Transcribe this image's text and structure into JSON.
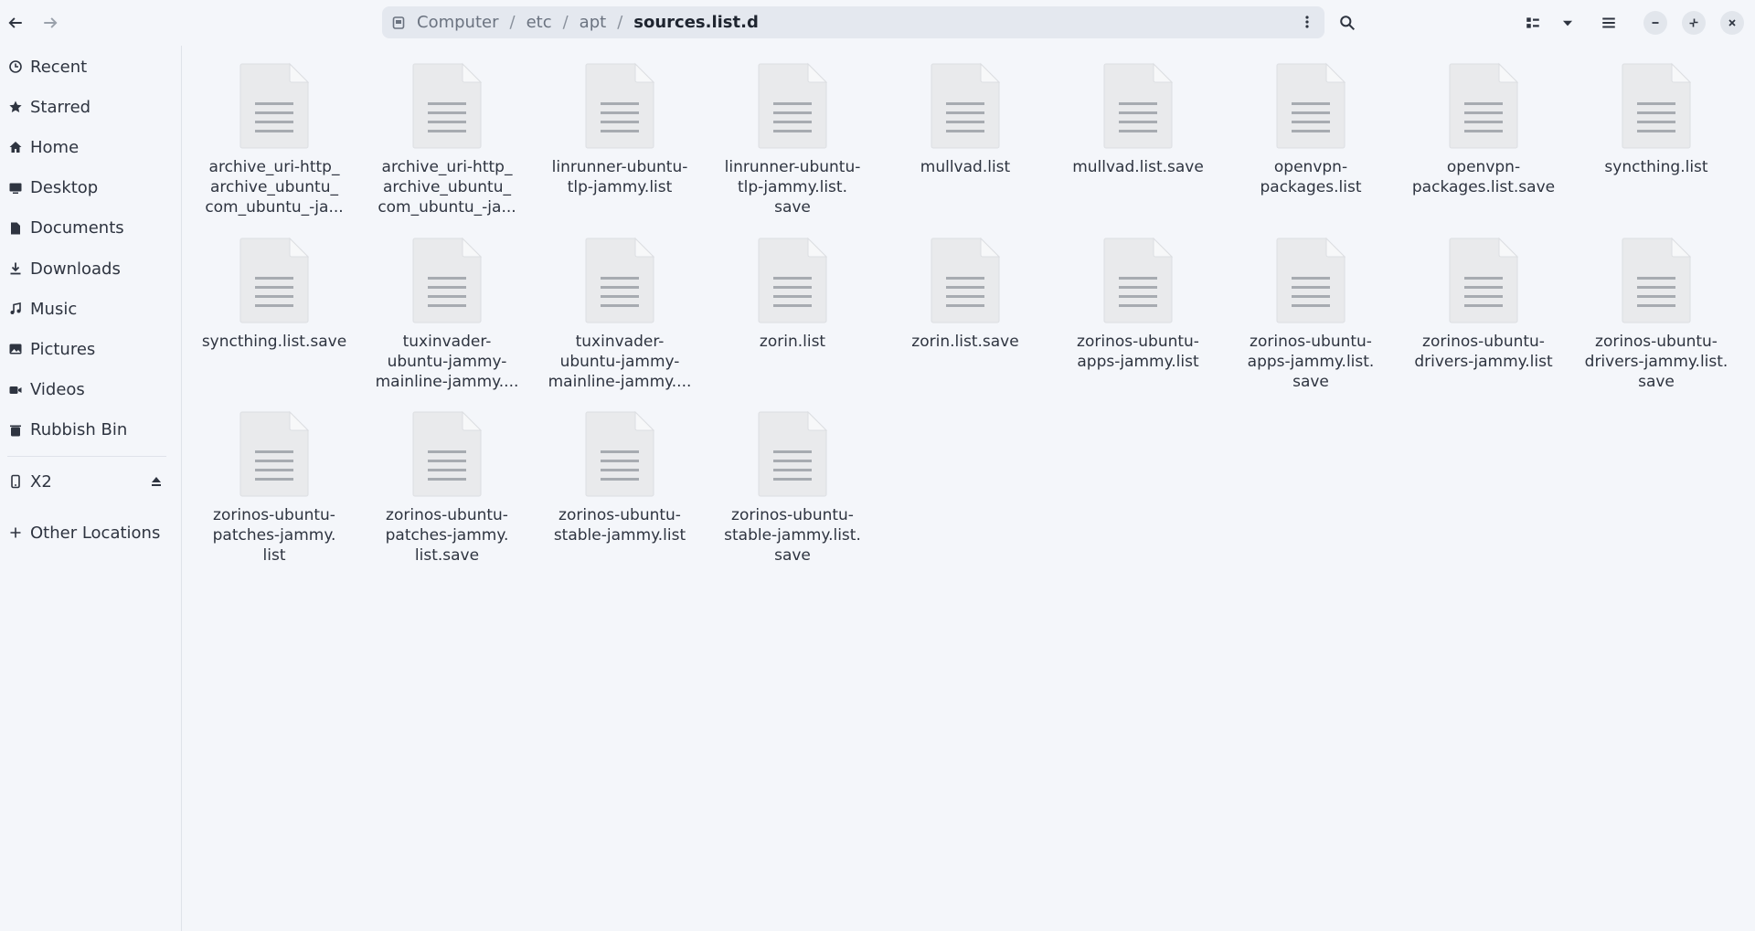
{
  "path": {
    "crumbs": [
      "Computer",
      "etc",
      "apt",
      "sources.list.d"
    ]
  },
  "sidebar": {
    "places": [
      {
        "label": "Recent",
        "icon": "clock-icon"
      },
      {
        "label": "Starred",
        "icon": "star-icon"
      },
      {
        "label": "Home",
        "icon": "home-icon"
      },
      {
        "label": "Desktop",
        "icon": "desktop-icon"
      },
      {
        "label": "Documents",
        "icon": "document-icon"
      },
      {
        "label": "Downloads",
        "icon": "download-icon"
      },
      {
        "label": "Music",
        "icon": "music-icon"
      },
      {
        "label": "Pictures",
        "icon": "picture-icon"
      },
      {
        "label": "Videos",
        "icon": "video-icon"
      },
      {
        "label": "Rubbish Bin",
        "icon": "trash-icon"
      }
    ],
    "devices": [
      {
        "label": "X2",
        "icon": "phone-icon"
      }
    ],
    "other": {
      "label": "Other Locations",
      "icon": "plus-icon"
    }
  },
  "files": [
    [
      "archive_uri-http_",
      "archive_ubuntu_",
      "com_ubuntu_-ja..."
    ],
    [
      "archive_uri-http_",
      "archive_ubuntu_",
      "com_ubuntu_-ja..."
    ],
    [
      "linrunner-ubuntu-",
      "tlp-jammy.list"
    ],
    [
      "linrunner-ubuntu-",
      "tlp-jammy.list.",
      "save"
    ],
    [
      "mullvad.list"
    ],
    [
      "mullvad.list.save"
    ],
    [
      "openvpn-",
      "packages.list"
    ],
    [
      "openvpn-",
      "packages.list.save"
    ],
    [
      "syncthing.list"
    ],
    [
      "syncthing.list.save"
    ],
    [
      "tuxinvader-",
      "ubuntu-jammy-",
      "mainline-jammy...."
    ],
    [
      "tuxinvader-",
      "ubuntu-jammy-",
      "mainline-jammy...."
    ],
    [
      "zorin.list"
    ],
    [
      "zorin.list.save"
    ],
    [
      "zorinos-ubuntu-",
      "apps-jammy.list"
    ],
    [
      "zorinos-ubuntu-",
      "apps-jammy.list.",
      "save"
    ],
    [
      "zorinos-ubuntu-",
      "drivers-jammy.list"
    ],
    [
      "zorinos-ubuntu-",
      "drivers-jammy.list.",
      "save"
    ],
    [
      "zorinos-ubuntu-",
      "patches-jammy.",
      "list"
    ],
    [
      "zorinos-ubuntu-",
      "patches-jammy.",
      "list.save"
    ],
    [
      "zorinos-ubuntu-",
      "stable-jammy.list"
    ],
    [
      "zorinos-ubuntu-",
      "stable-jammy.list.",
      "save"
    ]
  ],
  "colors": {
    "background": "#f4f6fa",
    "pathbar": "#e4e8ef",
    "file_icon": "#e9eaec",
    "file_lines": "#a7abb1"
  }
}
